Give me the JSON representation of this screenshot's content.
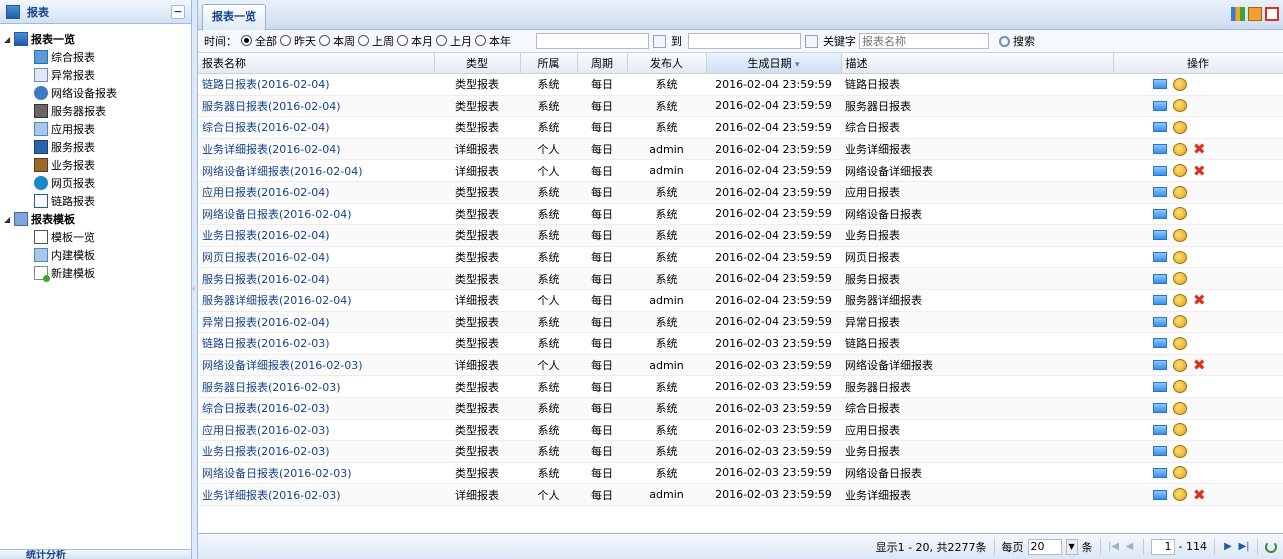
{
  "left_panel": {
    "title": "报表",
    "collapse_symbol": "−",
    "tree": [
      {
        "label": "报表一览",
        "icon": "chart-folder-icon",
        "children": [
          {
            "label": "综合报表",
            "icon": "chart-icon"
          },
          {
            "label": "异常报表",
            "icon": "chart-icon"
          },
          {
            "label": "网络设备报表",
            "icon": "monitor-icon"
          },
          {
            "label": "服务器报表",
            "icon": "server-icon"
          },
          {
            "label": "应用报表",
            "icon": "app-icon"
          },
          {
            "label": "服务报表",
            "icon": "service-icon"
          },
          {
            "label": "业务报表",
            "icon": "briefcase-icon"
          },
          {
            "label": "网页报表",
            "icon": "globe-icon"
          },
          {
            "label": "链路报表",
            "icon": "link-icon"
          }
        ]
      },
      {
        "label": "报表模板",
        "icon": "template-folder-icon",
        "children": [
          {
            "label": "模板一览",
            "icon": "list-icon"
          },
          {
            "label": "内建模板",
            "icon": "builtin-icon"
          },
          {
            "label": "新建模板",
            "icon": "new-icon"
          }
        ]
      }
    ],
    "bottom_title": "统计分析"
  },
  "tab": {
    "label": "报表一览"
  },
  "filter": {
    "time_label": "时间：",
    "options": [
      {
        "label": "全部",
        "checked": true
      },
      {
        "label": "昨天",
        "checked": false
      },
      {
        "label": "本周",
        "checked": false
      },
      {
        "label": "上周",
        "checked": false
      },
      {
        "label": "本月",
        "checked": false
      },
      {
        "label": "上月",
        "checked": false
      },
      {
        "label": "本年",
        "checked": false
      }
    ],
    "to_label": "到",
    "start_value": "",
    "end_value": "",
    "keyword_label": "关键字",
    "keyword_placeholder": "报表名称",
    "search_label": "搜索"
  },
  "grid": {
    "columns": [
      "报表名称",
      "类型",
      "所属",
      "周期",
      "发布人",
      "生成日期",
      "描述",
      "操作"
    ],
    "sort_indicator": "▾",
    "rows": [
      {
        "name": "链路日报表(2016-02-04)",
        "type": "类型报表",
        "owner": "系统",
        "period": "每日",
        "publisher": "系统",
        "date": "2016-02-04 23:59:59",
        "desc": "链路日报表",
        "deletable": false
      },
      {
        "name": "服务器日报表(2016-02-04)",
        "type": "类型报表",
        "owner": "系统",
        "period": "每日",
        "publisher": "系统",
        "date": "2016-02-04 23:59:59",
        "desc": "服务器日报表",
        "deletable": false
      },
      {
        "name": "综合日报表(2016-02-04)",
        "type": "类型报表",
        "owner": "系统",
        "period": "每日",
        "publisher": "系统",
        "date": "2016-02-04 23:59:59",
        "desc": "综合日报表",
        "deletable": false
      },
      {
        "name": "业务详细报表(2016-02-04)",
        "type": "详细报表",
        "owner": "个人",
        "period": "每日",
        "publisher": "admin",
        "date": "2016-02-04 23:59:59",
        "desc": "业务详细报表",
        "deletable": true
      },
      {
        "name": "网络设备详细报表(2016-02-04)",
        "type": "详细报表",
        "owner": "个人",
        "period": "每日",
        "publisher": "admin",
        "date": "2016-02-04 23:59:59",
        "desc": "网络设备详细报表",
        "deletable": true
      },
      {
        "name": "应用日报表(2016-02-04)",
        "type": "类型报表",
        "owner": "系统",
        "period": "每日",
        "publisher": "系统",
        "date": "2016-02-04 23:59:59",
        "desc": "应用日报表",
        "deletable": false
      },
      {
        "name": "网络设备日报表(2016-02-04)",
        "type": "类型报表",
        "owner": "系统",
        "period": "每日",
        "publisher": "系统",
        "date": "2016-02-04 23:59:59",
        "desc": "网络设备日报表",
        "deletable": false
      },
      {
        "name": "业务日报表(2016-02-04)",
        "type": "类型报表",
        "owner": "系统",
        "period": "每日",
        "publisher": "系统",
        "date": "2016-02-04 23:59:59",
        "desc": "业务日报表",
        "deletable": false
      },
      {
        "name": "网页日报表(2016-02-04)",
        "type": "类型报表",
        "owner": "系统",
        "period": "每日",
        "publisher": "系统",
        "date": "2016-02-04 23:59:59",
        "desc": "网页日报表",
        "deletable": false
      },
      {
        "name": "服务日报表(2016-02-04)",
        "type": "类型报表",
        "owner": "系统",
        "period": "每日",
        "publisher": "系统",
        "date": "2016-02-04 23:59:59",
        "desc": "服务日报表",
        "deletable": false
      },
      {
        "name": "服务器详细报表(2016-02-04)",
        "type": "详细报表",
        "owner": "个人",
        "period": "每日",
        "publisher": "admin",
        "date": "2016-02-04 23:59:59",
        "desc": "服务器详细报表",
        "deletable": true
      },
      {
        "name": "异常日报表(2016-02-04)",
        "type": "类型报表",
        "owner": "系统",
        "period": "每日",
        "publisher": "系统",
        "date": "2016-02-04 23:59:59",
        "desc": "异常日报表",
        "deletable": false
      },
      {
        "name": "链路日报表(2016-02-03)",
        "type": "类型报表",
        "owner": "系统",
        "period": "每日",
        "publisher": "系统",
        "date": "2016-02-03 23:59:59",
        "desc": "链路日报表",
        "deletable": false
      },
      {
        "name": "网络设备详细报表(2016-02-03)",
        "type": "详细报表",
        "owner": "个人",
        "period": "每日",
        "publisher": "admin",
        "date": "2016-02-03 23:59:59",
        "desc": "网络设备详细报表",
        "deletable": true
      },
      {
        "name": "服务器日报表(2016-02-03)",
        "type": "类型报表",
        "owner": "系统",
        "period": "每日",
        "publisher": "系统",
        "date": "2016-02-03 23:59:59",
        "desc": "服务器日报表",
        "deletable": false
      },
      {
        "name": "综合日报表(2016-02-03)",
        "type": "类型报表",
        "owner": "系统",
        "period": "每日",
        "publisher": "系统",
        "date": "2016-02-03 23:59:59",
        "desc": "综合日报表",
        "deletable": false
      },
      {
        "name": "应用日报表(2016-02-03)",
        "type": "类型报表",
        "owner": "系统",
        "period": "每日",
        "publisher": "系统",
        "date": "2016-02-03 23:59:59",
        "desc": "应用日报表",
        "deletable": false
      },
      {
        "name": "业务日报表(2016-02-03)",
        "type": "类型报表",
        "owner": "系统",
        "period": "每日",
        "publisher": "系统",
        "date": "2016-02-03 23:59:59",
        "desc": "业务日报表",
        "deletable": false
      },
      {
        "name": "网络设备日报表(2016-02-03)",
        "type": "类型报表",
        "owner": "系统",
        "period": "每日",
        "publisher": "系统",
        "date": "2016-02-03 23:59:59",
        "desc": "网络设备日报表",
        "deletable": false
      },
      {
        "name": "业务详细报表(2016-02-03)",
        "type": "详细报表",
        "owner": "个人",
        "period": "每日",
        "publisher": "admin",
        "date": "2016-02-03 23:59:59",
        "desc": "业务详细报表",
        "deletable": true
      }
    ]
  },
  "pager": {
    "display_text": "显示1 - 20, 共2277条",
    "per_page_label": "每页",
    "per_page_value": "20",
    "per_page_unit": "条",
    "current_page": "1",
    "total_pages": "- 114"
  },
  "colors": {
    "accent": "#15428b",
    "border": "#99bbe8",
    "delete": "#e03020"
  }
}
